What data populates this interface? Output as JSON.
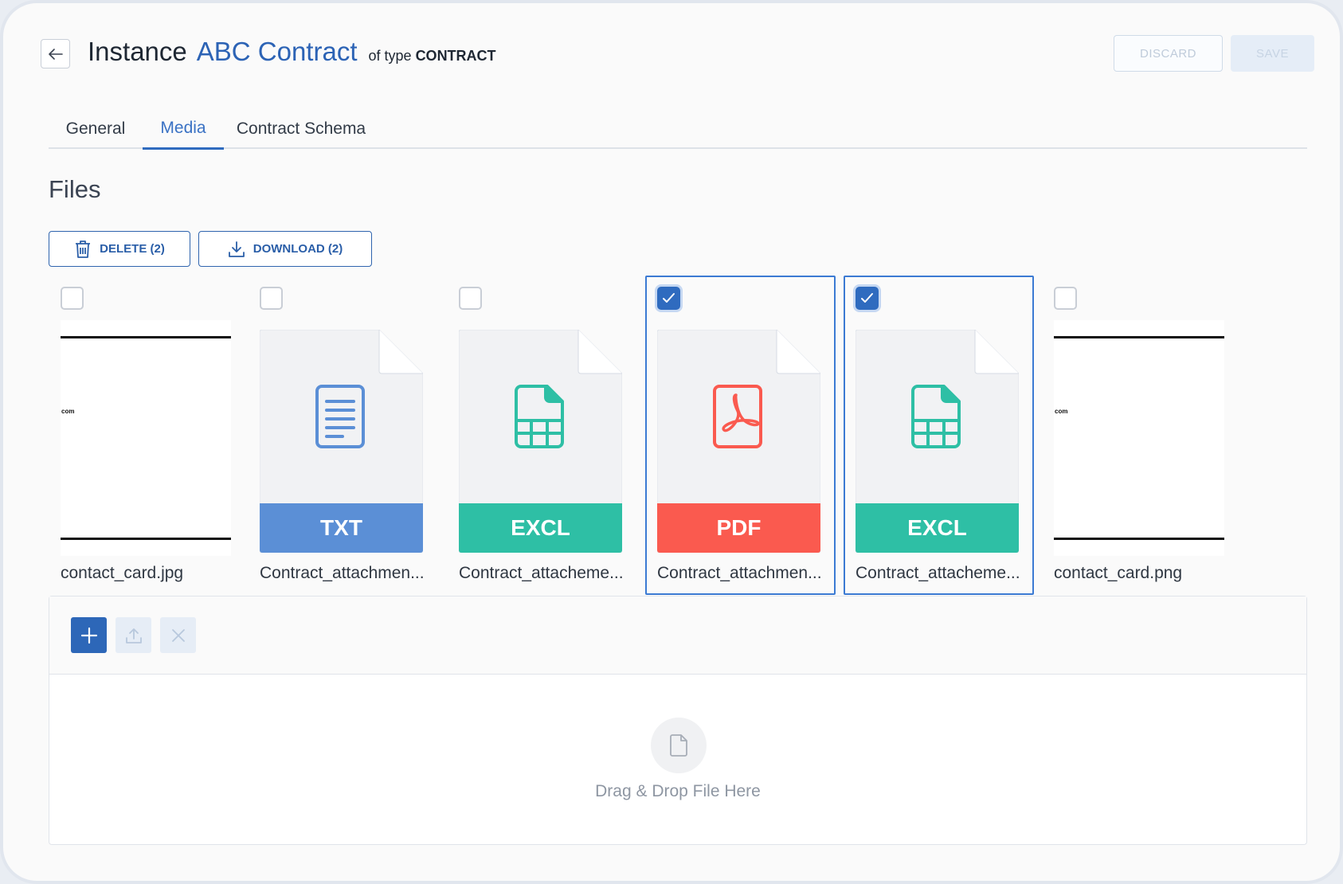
{
  "header": {
    "title_prefix": "Instance",
    "instance_name": "ABC Contract",
    "type_prefix": "of type",
    "type_name": "CONTRACT",
    "discard_label": "DISCARD",
    "save_label": "SAVE"
  },
  "tabs": [
    {
      "label": "General",
      "active": false
    },
    {
      "label": "Media",
      "active": true
    },
    {
      "label": "Contract Schema",
      "active": false
    }
  ],
  "files_section": {
    "title": "Files",
    "delete_label": "DELETE (2)",
    "download_label": "DOWNLOAD (2)",
    "files": [
      {
        "name": "contact_card.jpg",
        "kind": "image",
        "thumb_text": "com",
        "selected": false
      },
      {
        "name": "Contract_attachmen...",
        "kind": "TXT",
        "color": "#5b8fd6",
        "selected": false
      },
      {
        "name": "Contract_attacheme...",
        "kind": "EXCL",
        "color": "#2ebfa5",
        "selected": false
      },
      {
        "name": "Contract_attachmen...",
        "kind": "PDF",
        "color": "#fa5a4f",
        "selected": true
      },
      {
        "name": "Contract_attacheme...",
        "kind": "EXCL",
        "color": "#2ebfa5",
        "selected": true
      },
      {
        "name": "contact_card.png",
        "kind": "image",
        "thumb_text": "com",
        "selected": false
      }
    ]
  },
  "upload": {
    "drop_text": "Drag & Drop File Here",
    "icons": [
      "plus-icon",
      "upload-icon",
      "close-icon",
      "file-icon"
    ]
  },
  "colors": {
    "accent": "#2f6bbf",
    "txt": "#5b8fd6",
    "excel": "#2ebfa5",
    "pdf": "#fa5a4f"
  }
}
